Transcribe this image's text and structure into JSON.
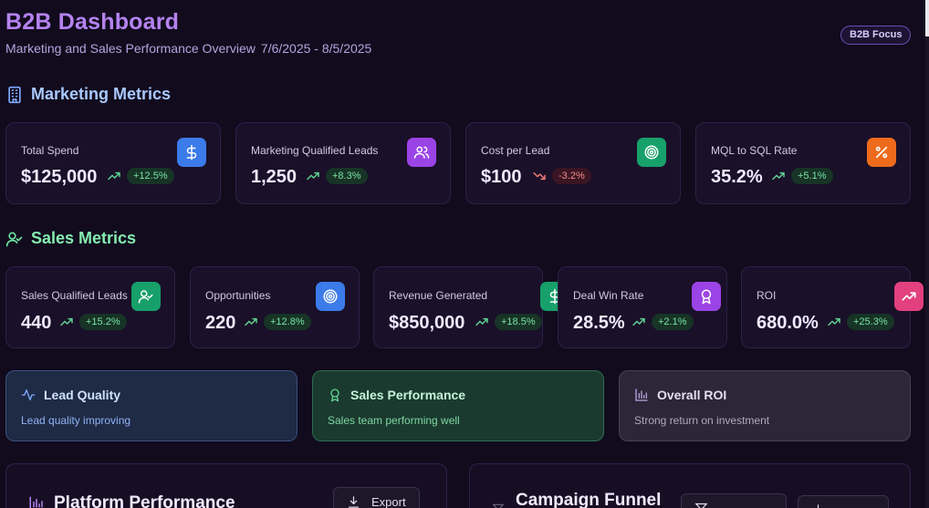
{
  "header": {
    "title": "B2B Dashboard",
    "subtitle": "Marketing and Sales Performance Overview",
    "date_range": "7/6/2025 - 8/5/2025",
    "focus_badge": "B2B Focus"
  },
  "sections": {
    "marketing": "Marketing Metrics",
    "sales": "Sales Metrics"
  },
  "marketing_metrics": [
    {
      "label": "Total Spend",
      "value": "$125,000",
      "change": "+12.5%",
      "trend": "up",
      "icon": "dollar-icon",
      "color": "#3b7bea"
    },
    {
      "label": "Marketing Qualified Leads",
      "value": "1,250",
      "change": "+8.3%",
      "trend": "up",
      "icon": "users-icon",
      "color": "#9b44e6"
    },
    {
      "label": "Cost per Lead",
      "value": "$100",
      "change": "-3.2%",
      "trend": "down",
      "icon": "target-icon",
      "color": "#17a06a"
    },
    {
      "label": "MQL to SQL Rate",
      "value": "35.2%",
      "change": "+5.1%",
      "trend": "up",
      "icon": "percent-icon",
      "color": "#ee6b1c"
    }
  ],
  "sales_metrics": [
    {
      "label": "Sales Qualified Leads",
      "value": "440",
      "change": "+15.2%",
      "trend": "up",
      "icon": "user-check-icon",
      "color": "#17a06a"
    },
    {
      "label": "Opportunities",
      "value": "220",
      "change": "+12.8%",
      "trend": "up",
      "icon": "target-icon",
      "color": "#3b7bea"
    },
    {
      "label": "Revenue Generated",
      "value": "$850,000",
      "change": "+18.5%",
      "trend": "up",
      "icon": "dollar-icon",
      "color": "#17a06a"
    },
    {
      "label": "Deal Win Rate",
      "value": "28.5%",
      "change": "+2.1%",
      "trend": "up",
      "icon": "award-icon",
      "color": "#9b44e6"
    },
    {
      "label": "ROI",
      "value": "680.0%",
      "change": "+25.3%",
      "trend": "up",
      "icon": "trending-up-icon",
      "color": "#e2407f"
    }
  ],
  "summaries": [
    {
      "title": "Lead Quality",
      "text": "Lead quality improving",
      "icon": "activity-icon"
    },
    {
      "title": "Sales Performance",
      "text": "Sales team performing well",
      "icon": "award-icon"
    },
    {
      "title": "Overall ROI",
      "text": "Strong return on investment",
      "icon": "bar-chart-icon"
    }
  ],
  "panels": {
    "platform": {
      "title": "Platform Performance",
      "export_label": "Export"
    },
    "campaign": {
      "title": "Campaign Funnel"
    }
  },
  "colors": {
    "background": "#110b1d",
    "accent": "#b583f0",
    "positive": "#79e2a5",
    "negative": "#f38d8d"
  }
}
